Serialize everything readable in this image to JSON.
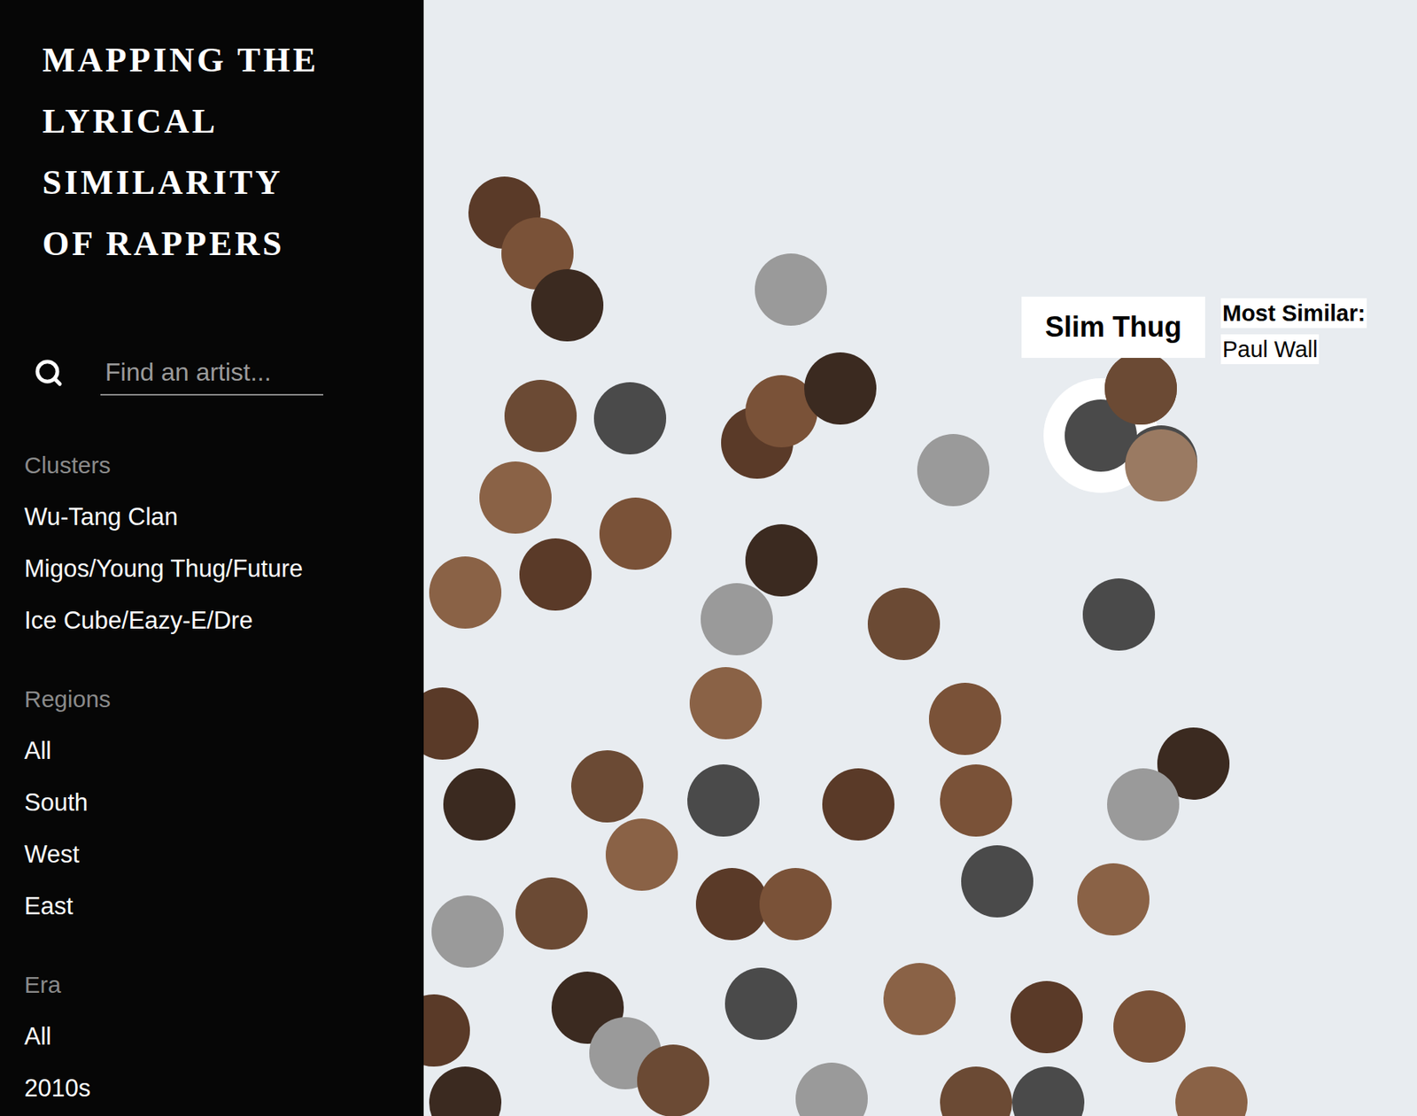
{
  "title": [
    "MAPPING THE",
    "LYRICAL",
    "SIMILARITY",
    "OF RAPPERS"
  ],
  "search": {
    "placeholder": "Find an artist..."
  },
  "sections": [
    {
      "label": "Clusters",
      "items": [
        {
          "label": "Wu-Tang Clan",
          "selected": false
        },
        {
          "label": "Migos/Young Thug/Future",
          "selected": false
        },
        {
          "label": "Ice Cube/Eazy-E/Dre",
          "selected": false
        }
      ]
    },
    {
      "label": "Regions",
      "items": [
        {
          "label": "All",
          "selected": false
        },
        {
          "label": "South",
          "selected": false
        },
        {
          "label": "West",
          "selected": false
        },
        {
          "label": "East",
          "selected": false
        }
      ]
    },
    {
      "label": "Era",
      "items": [
        {
          "label": "All",
          "selected": false
        },
        {
          "label": "2010s",
          "selected": false
        }
      ]
    }
  ],
  "tooltip": {
    "name": "Slim Thug",
    "label": "Most Similar:",
    "value": "Paul Wall"
  }
}
